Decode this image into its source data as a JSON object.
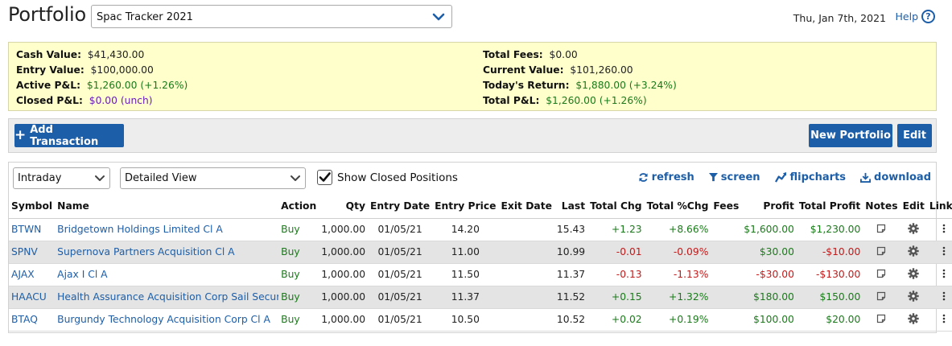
{
  "header": {
    "title": "Portfolio",
    "portfolio_selected": "Spac Tracker 2021",
    "date": "Thu, Jan 7th, 2021",
    "help_label": "Help"
  },
  "summary": {
    "left": [
      {
        "label": "Cash Value:",
        "value": "$41,430.00",
        "color": "default"
      },
      {
        "label": "Entry Value:",
        "value": "$100,000.00",
        "color": "default"
      },
      {
        "label": "Active P&L:",
        "value": "$1,260.00 (+1.26%)",
        "color": "green"
      },
      {
        "label": "Closed P&L:",
        "value": "$0.00 (unch)",
        "color": "purple"
      }
    ],
    "right": [
      {
        "label": "Total Fees:",
        "value": "$0.00",
        "color": "default"
      },
      {
        "label": "Current Value:",
        "value": "$101,260.00",
        "color": "default"
      },
      {
        "label": "Today's Return:",
        "value": "$1,880.00 (+3.24%)",
        "color": "green"
      },
      {
        "label": "Total P&L:",
        "value": "$1,260.00 (+1.26%)",
        "color": "green"
      }
    ]
  },
  "toolbar": {
    "add_transaction": "Add Transaction",
    "new_portfolio": "New Portfolio",
    "edit": "Edit"
  },
  "controls": {
    "period_selected": "Intraday",
    "view_selected": "Detailed View",
    "show_closed_label": "Show Closed Positions",
    "show_closed_checked": true,
    "refresh": "refresh",
    "screen": "screen",
    "flipcharts": "flipcharts",
    "download": "download"
  },
  "table": {
    "columns": [
      "Symbol",
      "Name",
      "Action",
      "Qty",
      "Entry Date",
      "Entry Price",
      "Exit Date",
      "Last",
      "Total Chg",
      "Total %Chg",
      "Fees",
      "Profit",
      "Total Profit",
      "Notes",
      "Edit",
      "Links"
    ],
    "rows": [
      {
        "symbol": "BTWN",
        "name": "Bridgetown Holdings Limited Cl A",
        "action": "Buy",
        "qty": "1,000.00",
        "entry_date": "01/05/21",
        "entry_price": "14.20",
        "exit_date": "",
        "last": "15.43",
        "total_chg": "+1.23",
        "total_pct_chg": "+8.66%",
        "fees": "",
        "profit": "$1,600.00",
        "total_profit": "$1,230.00",
        "dir_chg": "pos",
        "dir_profit": "pos",
        "dir_total": "pos"
      },
      {
        "symbol": "SPNV",
        "name": "Supernova Partners Acquisition Cl A",
        "action": "Buy",
        "qty": "1,000.00",
        "entry_date": "01/05/21",
        "entry_price": "11.00",
        "exit_date": "",
        "last": "10.99",
        "total_chg": "-0.01",
        "total_pct_chg": "-0.09%",
        "fees": "",
        "profit": "$30.00",
        "total_profit": "-$10.00",
        "dir_chg": "neg",
        "dir_profit": "pos",
        "dir_total": "neg"
      },
      {
        "symbol": "AJAX",
        "name": "Ajax I Cl A",
        "action": "Buy",
        "qty": "1,000.00",
        "entry_date": "01/05/21",
        "entry_price": "11.50",
        "exit_date": "",
        "last": "11.37",
        "total_chg": "-0.13",
        "total_pct_chg": "-1.13%",
        "fees": "",
        "profit": "-$30.00",
        "total_profit": "-$130.00",
        "dir_chg": "neg",
        "dir_profit": "neg",
        "dir_total": "neg"
      },
      {
        "symbol": "HAACU",
        "name": "Health Assurance Acquisition Corp Sail Securiti",
        "action": "Buy",
        "qty": "1,000.00",
        "entry_date": "01/05/21",
        "entry_price": "11.37",
        "exit_date": "",
        "last": "11.52",
        "total_chg": "+0.15",
        "total_pct_chg": "+1.32%",
        "fees": "",
        "profit": "$180.00",
        "total_profit": "$150.00",
        "dir_chg": "pos",
        "dir_profit": "pos",
        "dir_total": "pos"
      },
      {
        "symbol": "BTAQ",
        "name": "Burgundy Technology Acquisition Corp Cl A",
        "action": "Buy",
        "qty": "1,000.00",
        "entry_date": "01/05/21",
        "entry_price": "10.50",
        "exit_date": "",
        "last": "10.52",
        "total_chg": "+0.02",
        "total_pct_chg": "+0.19%",
        "fees": "",
        "profit": "$100.00",
        "total_profit": "$20.00",
        "dir_chg": "pos",
        "dir_profit": "pos",
        "dir_total": "pos"
      }
    ]
  },
  "colors": {
    "brand_blue": "#1d5ea8",
    "summary_bg": "#ffffcc",
    "positive": "#1a7a1a",
    "negative": "#c21a1a",
    "neutral_purple": "#6a1fb8"
  },
  "icons": {
    "help": "help-circle-icon",
    "dropdown": "chevron-down-icon",
    "check": "checkmark-icon",
    "refresh": "refresh-icon",
    "screen": "filter-icon",
    "flipcharts": "chart-line-icon",
    "download": "download-icon",
    "notes": "note-icon",
    "edit": "gear-icon",
    "links": "kebab-menu-icon"
  }
}
